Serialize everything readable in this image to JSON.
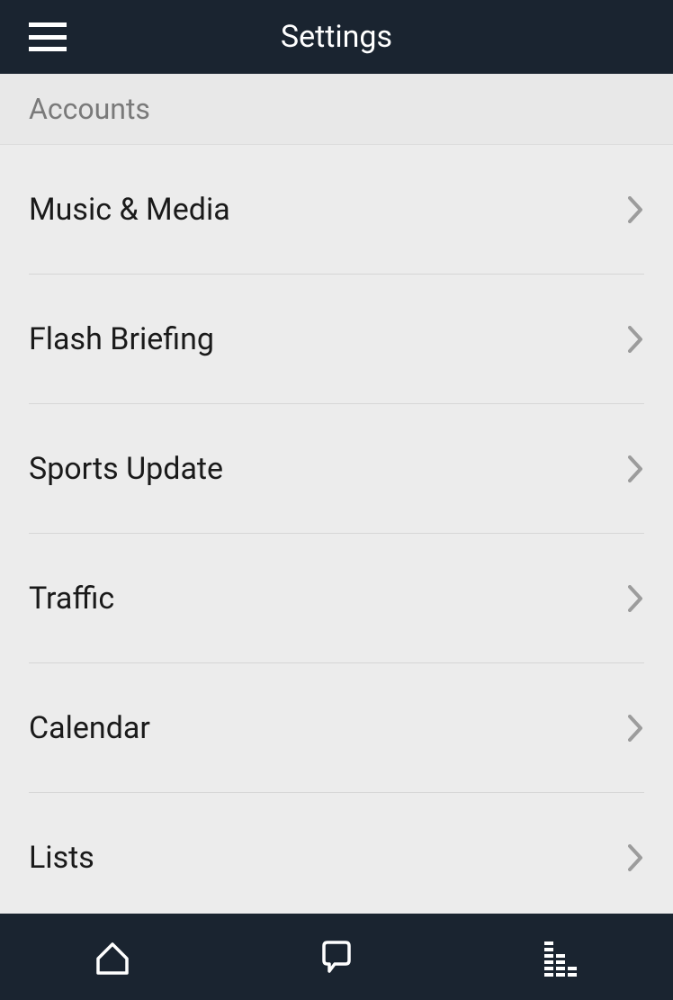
{
  "header": {
    "title": "Settings"
  },
  "sectionHeader": "Accounts",
  "items": [
    {
      "label": "Music & Media",
      "name": "music-media"
    },
    {
      "label": "Flash Briefing",
      "name": "flash-briefing"
    },
    {
      "label": "Sports Update",
      "name": "sports-update"
    },
    {
      "label": "Traffic",
      "name": "traffic"
    },
    {
      "label": "Calendar",
      "name": "calendar"
    },
    {
      "label": "Lists",
      "name": "lists"
    }
  ]
}
